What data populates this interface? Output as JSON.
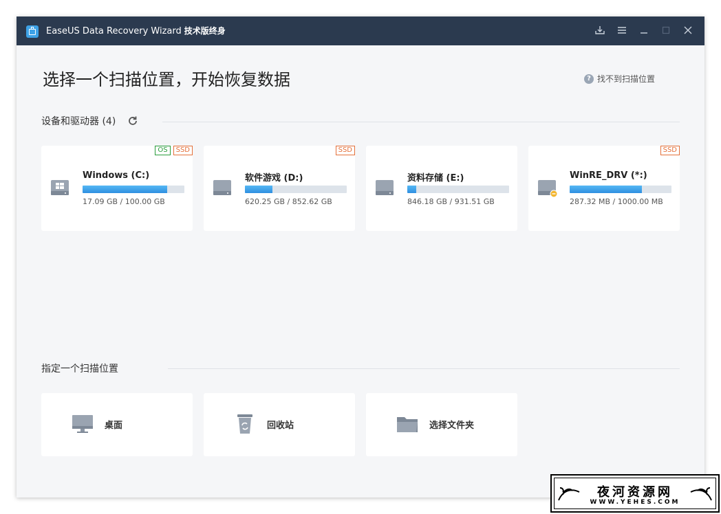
{
  "window": {
    "title": "EaseUS Data Recovery Wizard",
    "edition": "技术版终身"
  },
  "titlebar_buttons": [
    {
      "name": "download-icon"
    },
    {
      "name": "menu-icon"
    },
    {
      "name": "minimize-icon"
    },
    {
      "name": "maximize-icon"
    },
    {
      "name": "close-icon"
    }
  ],
  "page": {
    "title": "选择一个扫描位置，开始恢复数据",
    "help_link": "找不到扫描位置"
  },
  "devices": {
    "header": "设备和驱动器 (4)",
    "drives": [
      {
        "name": "Windows (C:)",
        "size_text": "17.09 GB / 100.00 GB",
        "used_fraction": 0.83,
        "badges": [
          "OS",
          "SSD"
        ],
        "icon": "windows-drive-icon"
      },
      {
        "name": "软件游戏 (D:)",
        "size_text": "620.25 GB / 852.62 GB",
        "used_fraction": 0.27,
        "badges": [
          "SSD"
        ],
        "icon": "hard-drive-icon"
      },
      {
        "name": "资料存储 (E:)",
        "size_text": "846.18 GB / 931.51 GB",
        "used_fraction": 0.09,
        "badges": [],
        "icon": "hard-drive-icon"
      },
      {
        "name": "WinRE_DRV (*:)",
        "size_text": "287.32 MB / 1000.00 MB",
        "used_fraction": 0.71,
        "badges": [
          "SSD"
        ],
        "icon": "hidden-drive-icon"
      }
    ]
  },
  "locations": {
    "header": "指定一个扫描位置",
    "items": [
      {
        "label": "桌面",
        "icon": "desktop-icon"
      },
      {
        "label": "回收站",
        "icon": "recycle-bin-icon"
      },
      {
        "label": "选择文件夹",
        "icon": "folder-icon"
      }
    ]
  },
  "watermark": {
    "title": "夜河资源网",
    "url": "WWW.YEHES.COM"
  },
  "colors": {
    "titlebar": "#2b3a4f",
    "accent": "#3ea2e6",
    "os_badge": "#2a9d3c",
    "ssd_badge": "#e4703a"
  }
}
